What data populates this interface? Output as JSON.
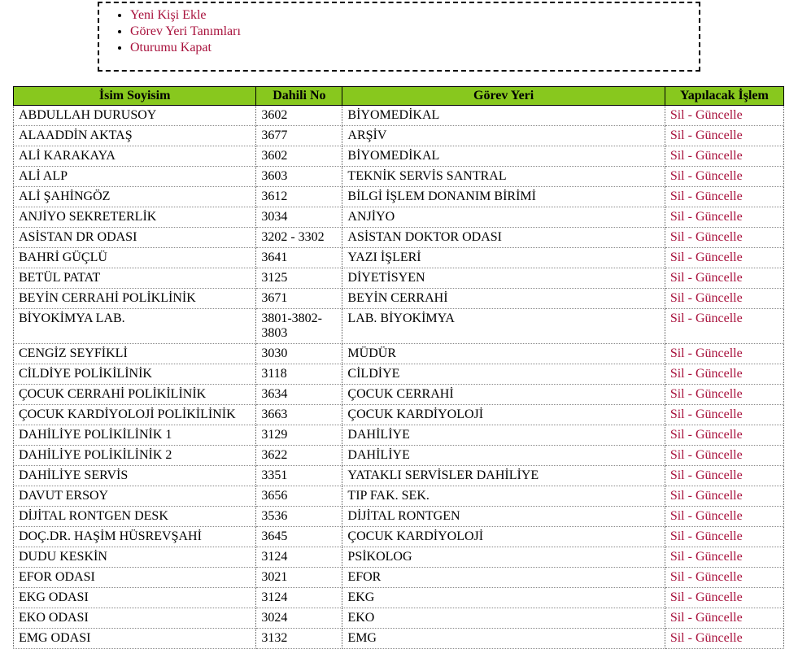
{
  "menu": {
    "items": [
      {
        "label": "Yeni Kişi Ekle"
      },
      {
        "label": "Görev Yeri Tanımları"
      },
      {
        "label": "Oturumu Kapat"
      }
    ]
  },
  "table": {
    "headers": {
      "name": "İsim Soyisim",
      "ext": "Dahili No",
      "dept": "Görev Yeri",
      "actions": "Yapılacak İşlem"
    },
    "action_labels": {
      "delete": "Sil",
      "sep": " - ",
      "update": "Güncelle"
    },
    "rows": [
      {
        "name": "ABDULLAH DURUSOY",
        "ext": "3602",
        "dept": "BİYOMEDİKAL"
      },
      {
        "name": "ALAADDİN AKTAŞ",
        "ext": "3677",
        "dept": "ARŞİV"
      },
      {
        "name": "ALİ KARAKAYA",
        "ext": "3602",
        "dept": "BİYOMEDİKAL"
      },
      {
        "name": "ALİ ALP",
        "ext": "3603",
        "dept": "TEKNİK SERVİS SANTRAL"
      },
      {
        "name": "ALİ ŞAHİNGÖZ",
        "ext": "3612",
        "dept": "BİLGİ İŞLEM DONANIM BİRİMİ"
      },
      {
        "name": "ANJİYO SEKRETERLİK",
        "ext": "3034",
        "dept": "ANJİYO"
      },
      {
        "name": "ASİSTAN DR ODASI",
        "ext": "3202 - 3302",
        "dept": "ASİSTAN DOKTOR ODASI"
      },
      {
        "name": "BAHRİ GÜÇLÜ",
        "ext": "3641",
        "dept": "YAZI İŞLERİ"
      },
      {
        "name": "BETÜL PATAT",
        "ext": "3125",
        "dept": "DİYETİSYEN"
      },
      {
        "name": "BEYİN CERRAHİ POLİKLİNİK",
        "ext": "3671",
        "dept": "BEYİN CERRAHİ"
      },
      {
        "name": "BİYOKİMYA LAB.",
        "ext": "3801-3802-3803",
        "dept": "LAB. BİYOKİMYA"
      },
      {
        "name": "CENGİZ SEYFİKLİ",
        "ext": "3030",
        "dept": "MÜDÜR"
      },
      {
        "name": "CİLDİYE POLİKİLİNİK",
        "ext": "3118",
        "dept": "CİLDİYE"
      },
      {
        "name": "ÇOCUK CERRAHİ POLİKİLİNİK",
        "ext": "3634",
        "dept": "ÇOCUK CERRAHİ"
      },
      {
        "name": "ÇOCUK KARDİYOLOJİ POLİKİLİNİK",
        "ext": "3663",
        "dept": "ÇOCUK KARDİYOLOJİ"
      },
      {
        "name": "DAHİLİYE POLİKİLİNİK 1",
        "ext": "3129",
        "dept": "DAHİLİYE"
      },
      {
        "name": "DAHİLİYE POLİKİLİNİK 2",
        "ext": "3622",
        "dept": "DAHİLİYE"
      },
      {
        "name": "DAHİLİYE SERVİS",
        "ext": "3351",
        "dept": "YATAKLI SERVİSLER DAHİLİYE"
      },
      {
        "name": "DAVUT ERSOY",
        "ext": "3656",
        "dept": "TIP FAK. SEK."
      },
      {
        "name": "DİJİTAL RONTGEN DESK",
        "ext": "3536",
        "dept": "DİJİTAL RONTGEN"
      },
      {
        "name": "DOÇ.DR. HAŞİM HÜSREVŞAHİ",
        "ext": "3645",
        "dept": "ÇOCUK KARDİYOLOJİ"
      },
      {
        "name": "DUDU KESKİN",
        "ext": "3124",
        "dept": "PSİKOLOG"
      },
      {
        "name": "EFOR ODASI",
        "ext": "3021",
        "dept": "EFOR"
      },
      {
        "name": "EKG ODASI",
        "ext": "3124",
        "dept": "EKG"
      },
      {
        "name": "EKO ODASI",
        "ext": "3024",
        "dept": "EKO"
      },
      {
        "name": "EMG ODASI",
        "ext": "3132",
        "dept": "EMG"
      }
    ]
  }
}
